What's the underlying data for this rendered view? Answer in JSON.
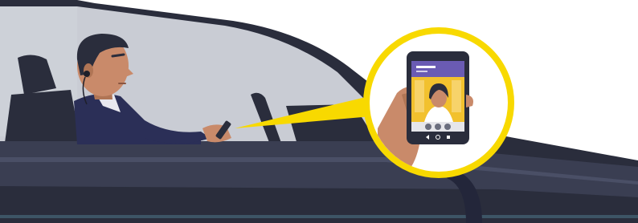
{
  "illustration": {
    "subject": "driver-using-phone-while-driving",
    "icons": [
      "car-icon",
      "driver-icon",
      "earbud-icon",
      "handheld-phone-icon",
      "magnified-phone-icon",
      "video-call-contact-icon",
      "mute-icon",
      "video-icon",
      "end-call-icon"
    ]
  },
  "colors": {
    "car_body_dark": "#2a2d3c",
    "car_body_mid": "#3a3e52",
    "car_glass": "#c9ccd4",
    "highlight_ring": "#f8d900",
    "phone_app_bar": "#6a5bb3",
    "video_background": "#f2c12e",
    "skin": "#c98a6a"
  }
}
